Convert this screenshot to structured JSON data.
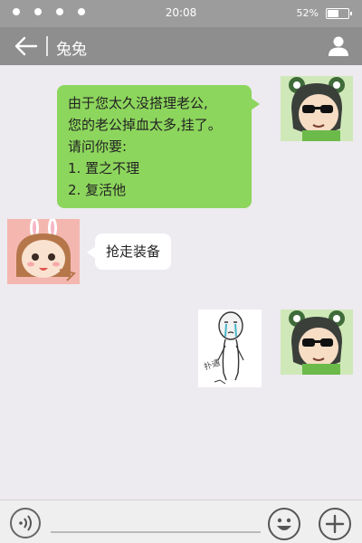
{
  "status_bar": {
    "time": "20:08",
    "battery_percent": "52%",
    "battery_level": 0.52
  },
  "nav": {
    "title": "兔兔",
    "back_icon": "arrow-left-icon",
    "profile_icon": "person-icon"
  },
  "messages": [
    {
      "sender": "self",
      "type": "text",
      "lines": [
        "由于您太久没搭理老公,",
        "您的老公掉血太多,挂了。",
        "请问你要:",
        "1. 置之不理",
        "2. 复活他"
      ]
    },
    {
      "sender": "other",
      "type": "text",
      "lines": [
        "抢走装备"
      ]
    },
    {
      "sender": "self",
      "type": "sticker",
      "caption": "扑通"
    }
  ],
  "colors": {
    "status_bar": "#9c9c9c",
    "nav_bar": "#8e8e8e",
    "chat_bg": "#edeaf0",
    "self_bubble": "#8dd65d",
    "other_bubble": "#ffffff"
  },
  "input_bar": {
    "voice_icon": "voice-icon",
    "emoji_icon": "smiley-icon",
    "plus_icon": "plus-icon"
  }
}
